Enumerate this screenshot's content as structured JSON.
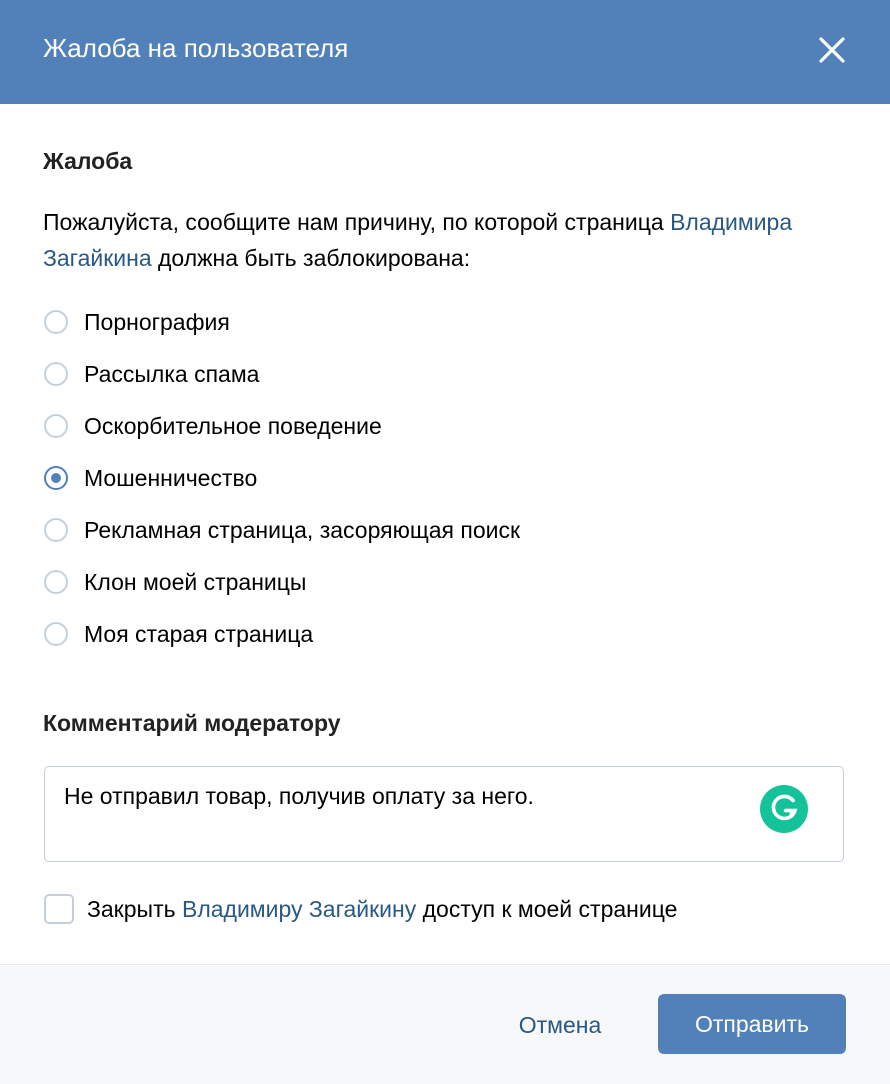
{
  "dialog": {
    "title": "Жалоба на пользователя"
  },
  "complaint": {
    "section_title": "Жалоба",
    "intro_before": "Пожалуйста, сообщите нам причину, по которой страница ",
    "intro_link": "Владимира Загайкина",
    "intro_after": " должна быть заблокирована:",
    "options": [
      {
        "label": "Порнография",
        "checked": false
      },
      {
        "label": "Рассылка спама",
        "checked": false
      },
      {
        "label": "Оскорбительное поведение",
        "checked": false
      },
      {
        "label": "Мошенничество",
        "checked": true
      },
      {
        "label": "Рекламная страница, засоряющая поиск",
        "checked": false
      },
      {
        "label": "Клон моей страницы",
        "checked": false
      },
      {
        "label": "Моя старая страница",
        "checked": false
      }
    ]
  },
  "comment": {
    "section_title": "Комментарий модератору",
    "value": "Не отправил товар, получив оплату за него."
  },
  "block_access": {
    "checked": false,
    "before": "Закрыть ",
    "link": "Владимиру Загайкину",
    "after": " доступ к моей странице"
  },
  "footer": {
    "cancel_label": "Отмена",
    "submit_label": "Отправить"
  },
  "icons": {
    "close": "close-icon",
    "grammarly": "grammarly-icon"
  },
  "colors": {
    "header_bg": "#5181b8",
    "link": "#2a5885",
    "accent": "#5181b8",
    "grammarly": "#15c39a"
  }
}
